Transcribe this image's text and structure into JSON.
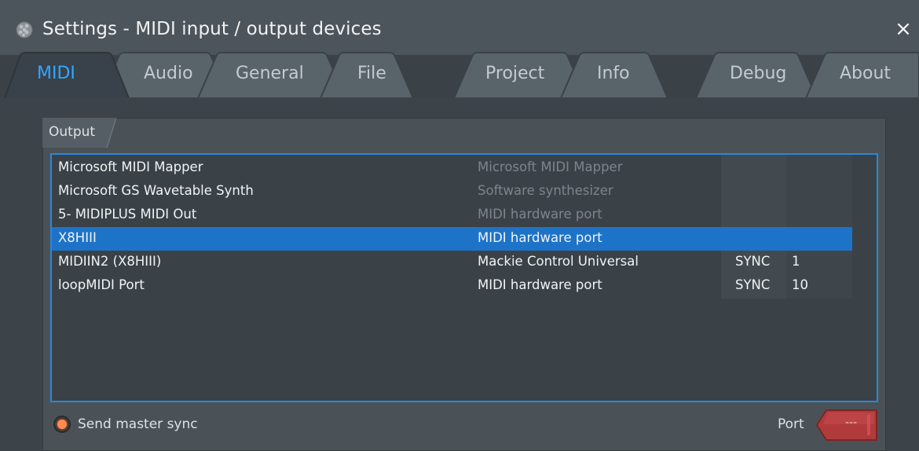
{
  "window": {
    "title": "Settings - MIDI input / output devices",
    "close_glyph": "×"
  },
  "tabs": [
    {
      "label": "MIDI",
      "active": true
    },
    {
      "label": "Audio",
      "active": false
    },
    {
      "label": "General",
      "active": false
    },
    {
      "label": "File",
      "active": false
    },
    {
      "label": "Project",
      "active": false
    },
    {
      "label": "Info",
      "active": false
    },
    {
      "label": "Debug",
      "active": false
    },
    {
      "label": "About",
      "active": false
    }
  ],
  "output": {
    "group_label": "Output",
    "devices": [
      {
        "name": "Microsoft MIDI Mapper",
        "type": "Microsoft MIDI Mapper",
        "dim": true,
        "sync": "",
        "port": "",
        "selected": false
      },
      {
        "name": "Microsoft GS Wavetable Synth",
        "type": "Software synthesizer",
        "dim": true,
        "sync": "",
        "port": "",
        "selected": false
      },
      {
        "name": "5- MIDIPLUS MIDI Out",
        "type": "MIDI hardware port",
        "dim": true,
        "sync": "",
        "port": "",
        "selected": false
      },
      {
        "name": "X8HIII",
        "type": "MIDI hardware port",
        "dim": false,
        "sync": "",
        "port": "",
        "selected": true
      },
      {
        "name": "MIDIIN2 (X8HIII)",
        "type": "Mackie Control Universal",
        "dim": false,
        "sync": "SYNC",
        "port": "1",
        "selected": false
      },
      {
        "name": "loopMIDI Port",
        "type": "MIDI hardware port",
        "dim": false,
        "sync": "SYNC",
        "port": "10",
        "selected": false
      }
    ],
    "send_master_sync_label": "Send master sync",
    "send_master_sync_checked": true,
    "port_label": "Port",
    "port_value": "---"
  },
  "colors": {
    "accent": "#2b87d9",
    "active_tab": "#31a7ff",
    "selection": "#1d73c8",
    "port_field": "#b03a3c",
    "radio_on": "#ff8c4e"
  },
  "icons": {
    "app": "fl-studio-fruit-icon",
    "close": "close-icon"
  }
}
